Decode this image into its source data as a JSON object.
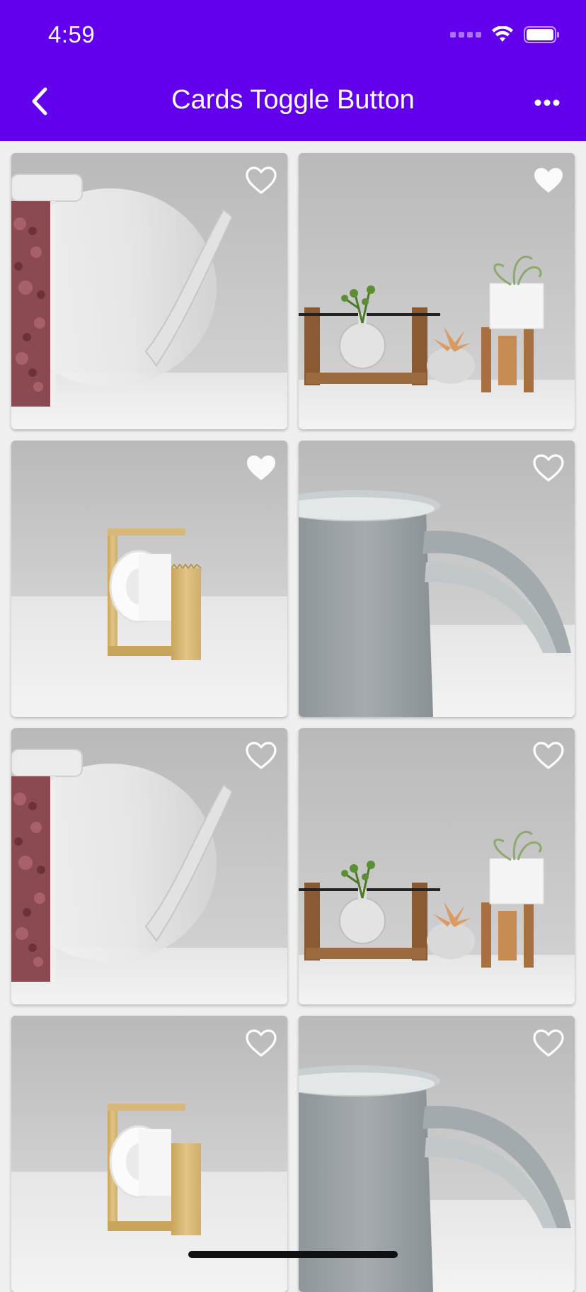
{
  "status": {
    "time": "4:59"
  },
  "appbar": {
    "title": "Cards Toggle Button"
  },
  "cards": [
    {
      "subject": "glass-teapot",
      "favorited": false
    },
    {
      "subject": "plant-stands",
      "favorited": true
    },
    {
      "subject": "tape-dispenser",
      "favorited": true
    },
    {
      "subject": "gray-mug",
      "favorited": false
    },
    {
      "subject": "glass-teapot",
      "favorited": false
    },
    {
      "subject": "plant-stands",
      "favorited": false
    },
    {
      "subject": "tape-dispenser",
      "favorited": false
    },
    {
      "subject": "gray-mug",
      "favorited": false
    }
  ],
  "colors": {
    "appbar": "#6200ee",
    "icon": "#ffffff"
  }
}
